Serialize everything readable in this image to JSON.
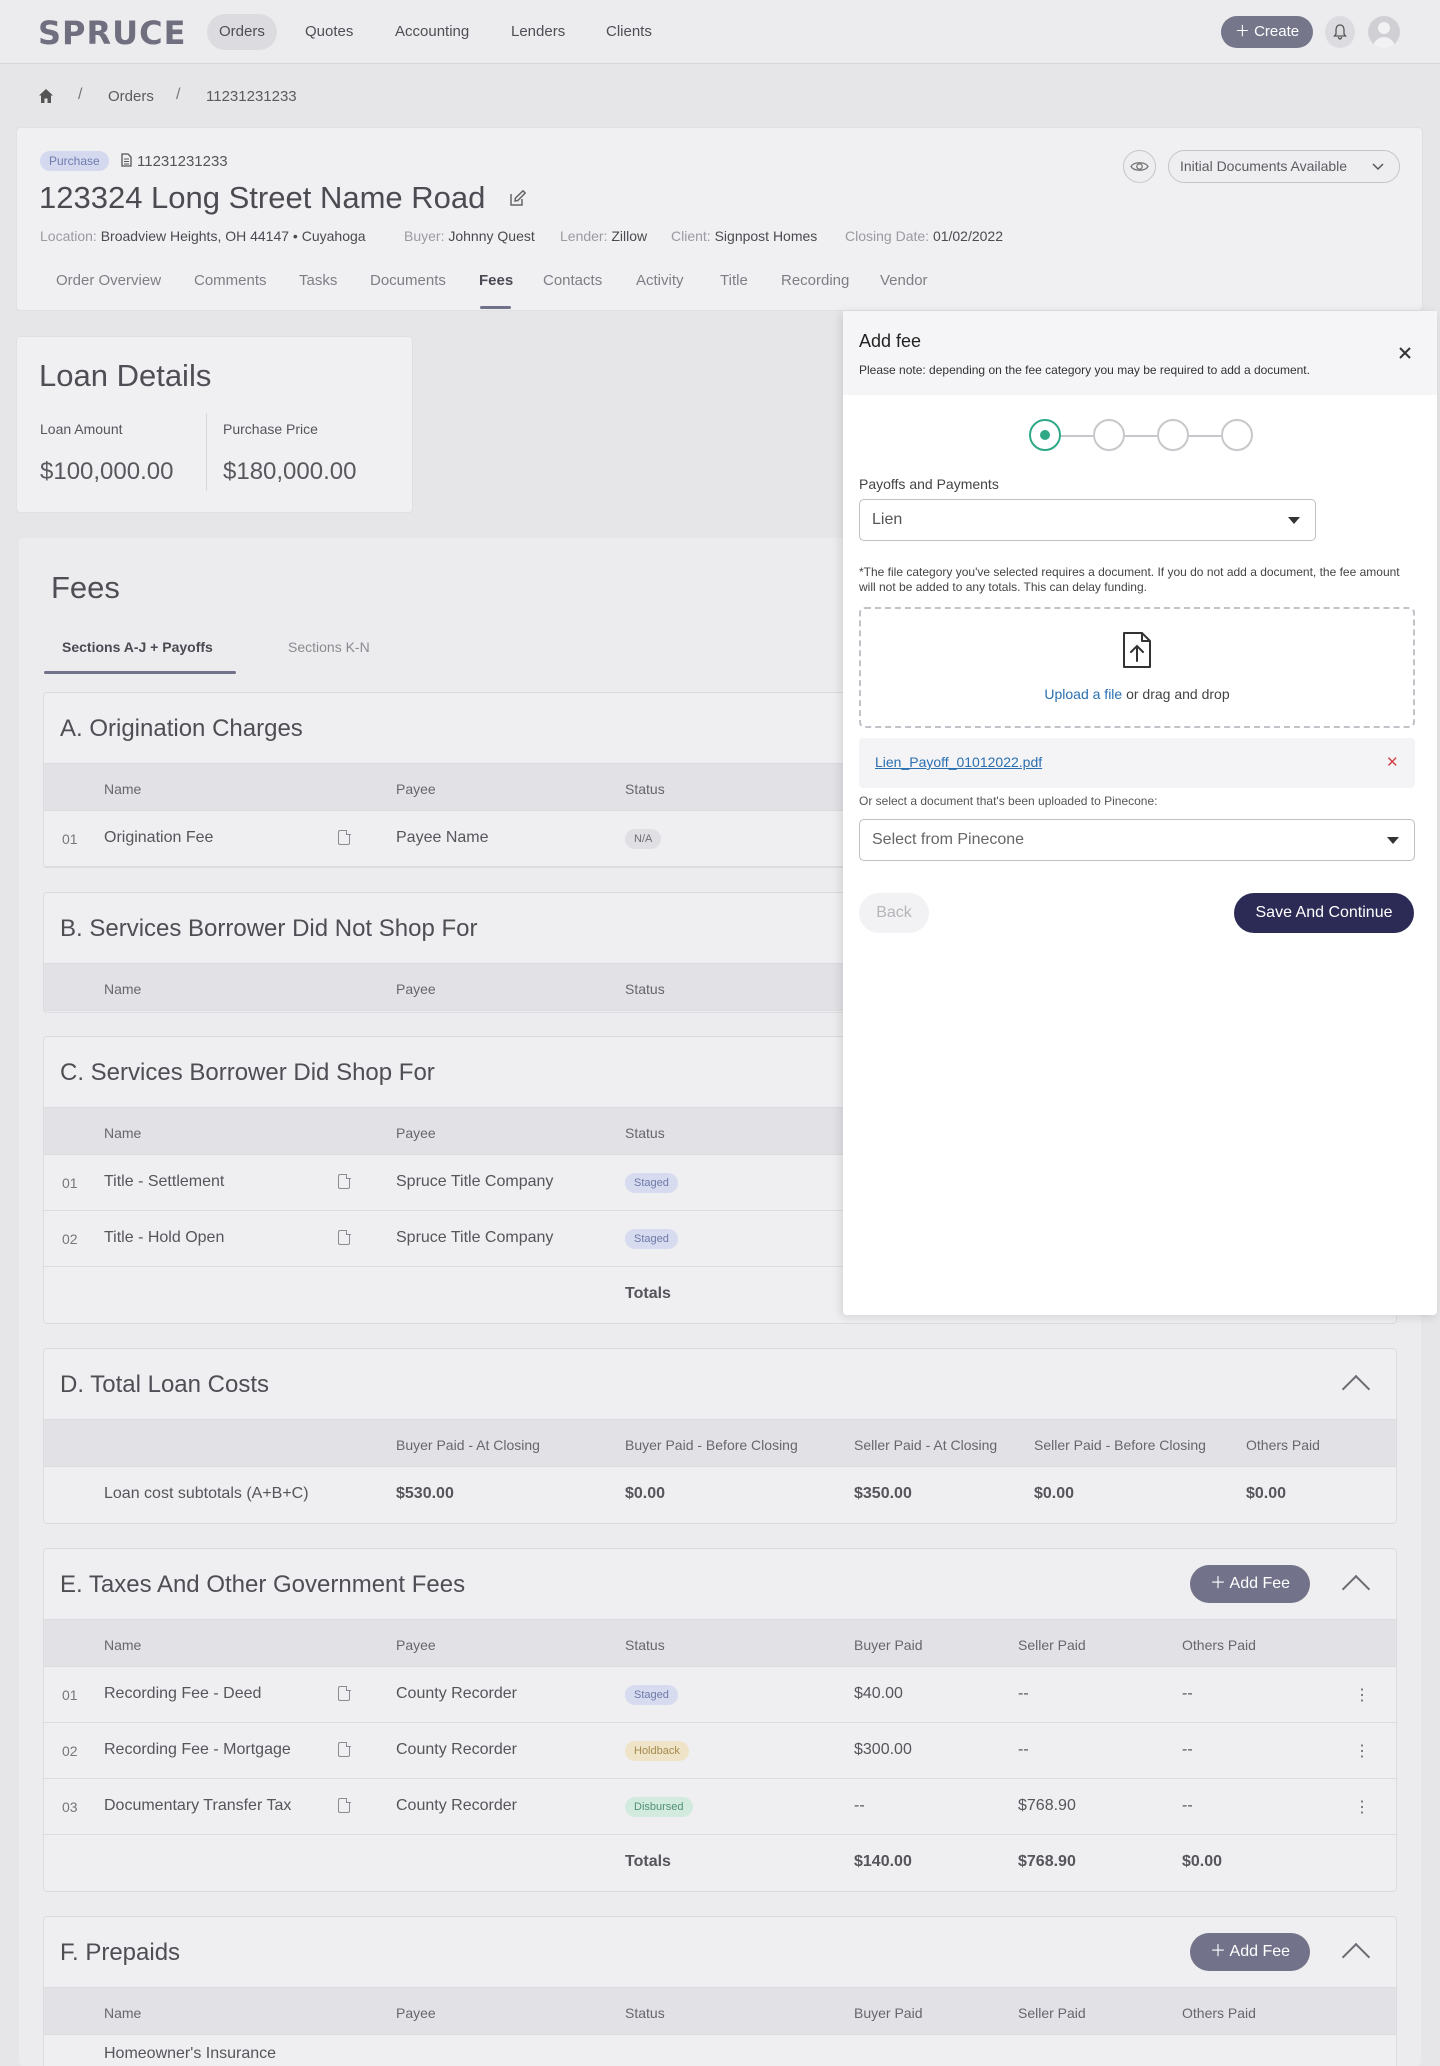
{
  "nav": {
    "logo": "SPRUCE",
    "items": [
      "Orders",
      "Quotes",
      "Accounting",
      "Lenders",
      "Clients"
    ],
    "create_label": "Create"
  },
  "breadcrumb": {
    "items": [
      "Orders",
      "11231231233"
    ],
    "separator": "/"
  },
  "order": {
    "type_badge": "Purchase",
    "number": "11231231233",
    "title": "123324 Long Street Name Road",
    "status": "Initial Documents Available",
    "meta": [
      {
        "label": "Location:",
        "value": "Broadview Heights, OH 44147 • Cuyahoga"
      },
      {
        "label": "Buyer:",
        "value": "Johnny Quest"
      },
      {
        "label": "Lender:",
        "value": "Zillow"
      },
      {
        "label": "Client:",
        "value": "Signpost Homes"
      },
      {
        "label": "Closing Date:",
        "value": "01/02/2022"
      }
    ],
    "tabs": [
      "Order Overview",
      "Comments",
      "Tasks",
      "Documents",
      "Fees",
      "Contacts",
      "Activity",
      "Title",
      "Recording",
      "Vendor"
    ],
    "active_tab": "Fees"
  },
  "loan_details": {
    "title": "Loan Details",
    "loan_amount_label": "Loan Amount",
    "loan_amount": "$100,000.00",
    "purchase_price_label": "Purchase Price",
    "purchase_price": "$180,000.00"
  },
  "fees": {
    "title": "Fees",
    "subtabs": [
      "Sections A-J + Payoffs",
      "Sections K-N"
    ],
    "cols": {
      "name": "Name",
      "payee": "Payee",
      "status": "Status",
      "buyer_paid": "Buyer Paid",
      "seller_paid": "Seller Paid",
      "others_paid": "Others Paid",
      "totals": "Totals"
    },
    "section_a": {
      "title": "A. Origination Charges",
      "rows": [
        {
          "num": "01",
          "name": "Origination Fee",
          "payee": "Payee Name",
          "status": "N/A"
        }
      ]
    },
    "section_b": {
      "title": "B. Services Borrower Did Not Shop For"
    },
    "section_c": {
      "title": "C. Services Borrower Did Shop For",
      "rows": [
        {
          "num": "01",
          "name": "Title - Settlement",
          "payee": "Spruce Title Company",
          "status": "Staged"
        },
        {
          "num": "02",
          "name": "Title - Hold Open",
          "payee": "Spruce Title Company",
          "status": "Staged"
        }
      ]
    },
    "section_d": {
      "title": "D. Total Loan Costs",
      "cols": [
        "Buyer Paid - At Closing",
        "Buyer Paid - Before Closing",
        "Seller Paid - At Closing",
        "Seller Paid - Before Closing",
        "Others Paid"
      ],
      "row_label": "Loan cost subtotals (A+B+C)",
      "values": [
        "$530.00",
        "$0.00",
        "$350.00",
        "$0.00",
        "$0.00"
      ]
    },
    "section_e": {
      "title": "E. Taxes And Other Government Fees",
      "add_label": "Add Fee",
      "rows": [
        {
          "num": "01",
          "name": "Recording Fee - Deed",
          "payee": "County Recorder",
          "status": "Staged",
          "buyer": "$40.00",
          "seller": "--",
          "others": "--"
        },
        {
          "num": "02",
          "name": "Recording Fee - Mortgage",
          "payee": "County Recorder",
          "status": "Holdback",
          "buyer": "$300.00",
          "seller": "--",
          "others": "--"
        },
        {
          "num": "03",
          "name": "Documentary Transfer Tax",
          "payee": "County Recorder",
          "status": "Disbursed",
          "buyer": "--",
          "seller": "$768.90",
          "others": "--"
        }
      ],
      "totals": {
        "buyer": "$140.00",
        "seller": "$768.90",
        "others": "$0.00"
      }
    },
    "section_f": {
      "title": "F. Prepaids",
      "add_label": "Add Fee",
      "rows": [
        {
          "name": "Homeowner's Insurance"
        }
      ]
    }
  },
  "drawer": {
    "title": "Add fee",
    "note": "Please note: depending on the fee category you may be required to add a document.",
    "category_label": "Payoffs and Payments",
    "category_value": "Lien",
    "warning": "*The file category you've selected requires a document. If you do not add a document, the fee amount will not be added to any totals. This can delay funding.",
    "upload_link": "Upload a file",
    "upload_rest": " or drag and drop",
    "file_name": "Lien_Payoff_01012022.pdf",
    "select_label": "Or select a document that's been uploaded to Pinecone:",
    "select_placeholder": "Select from Pinecone",
    "back_label": "Back",
    "save_label": "Save And Continue"
  }
}
